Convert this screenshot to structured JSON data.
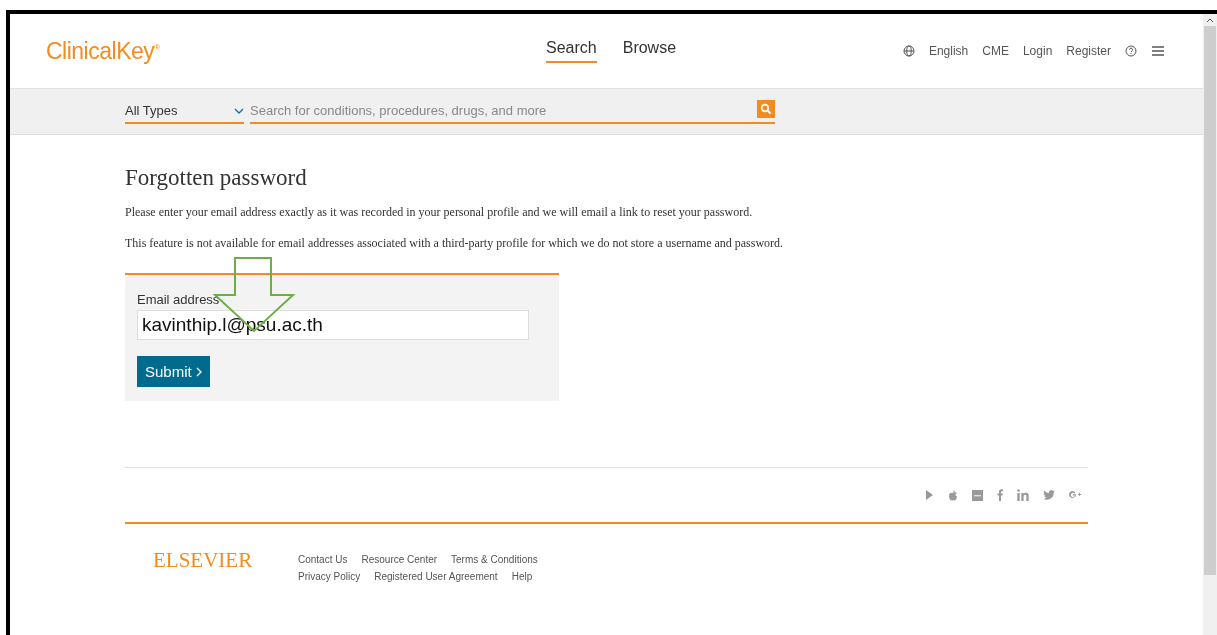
{
  "header": {
    "logo": "ClinicalKey",
    "logo_mark": "®",
    "tabs": [
      {
        "label": "Search",
        "selected": true
      },
      {
        "label": "Browse",
        "selected": false
      }
    ],
    "links": [
      "English",
      "CME",
      "Login",
      "Register"
    ]
  },
  "search_bar": {
    "type_select": "All Types",
    "placeholder": "Search for conditions, procedures, drugs, and more"
  },
  "content": {
    "title": "Forgotten password",
    "paragraphs": [
      "Please enter your email address exactly as it was recorded in your personal profile and we will email a link to reset your password.",
      "This feature is not available for email addresses associated with a third-party profile for which we do not store a username and password."
    ],
    "form": {
      "label": "Email address",
      "value": "kavinthip.l@psu.ac.th",
      "submit": "Submit"
    }
  },
  "footer": {
    "brand": "ELSEVIER",
    "link_rows": [
      [
        "Contact Us",
        "Resource Center",
        "Terms & Conditions"
      ],
      [
        "Privacy Policy",
        "Registered User Agreement",
        "Help"
      ]
    ]
  }
}
